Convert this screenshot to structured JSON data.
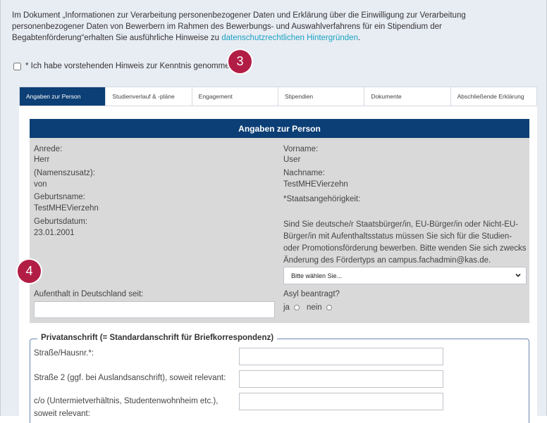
{
  "intro": {
    "text_before_link": "Im Dokument „Informationen zur Verarbeitung personenbezogener Daten und Erklärung über die Einwilligung zur Verarbeitung personenbezogener Daten von Bewerbern im Rahmen des Bewerbungs- und Auswahlverfahrens für ein Stipendium der Begabtenförderung“erhalten Sie ausführliche Hinweise zu ",
    "link_text": "datenschutzrechtlichen Hintergründen",
    "text_after_link": "."
  },
  "consent": {
    "label": "* Ich habe vorstehenden Hinweis zur Kenntnis genommen"
  },
  "badges": {
    "three": "3",
    "four": "4"
  },
  "tabs": [
    {
      "label": "Angaben zur Person"
    },
    {
      "label": "Studienverlauf & -pläne"
    },
    {
      "label": "Engagement"
    },
    {
      "label": "Stipendien"
    },
    {
      "label": "Dokumente"
    },
    {
      "label": "Abschließende Erklärung"
    }
  ],
  "section": {
    "title": "Angaben zur Person"
  },
  "person": {
    "anrede_label": "Anrede:",
    "anrede_value": "Herr",
    "namenszusatz_label": "(Namenszusatz):",
    "namenszusatz_value": "von",
    "geburtsname_label": "Geburtsname:",
    "geburtsname_value": "TestMHEVierzehn",
    "geburtsdatum_label": "Geburtsdatum:",
    "geburtsdatum_value": "23.01.2001",
    "vorname_label": "Vorname:",
    "vorname_value": "User",
    "nachname_label": "Nachname:",
    "nachname_value": "TestMHEVierzehn",
    "staat_label": "*Staatsangehörigkeit:",
    "staat_hint": "Sind Sie deutsche/r Staatsbürger/in, EU-Bürger/in oder Nicht-EU-Bürger/in mit Aufenthaltsstatus müssen Sie sich für die Studien- oder Promotionsförderung bewerben. Bitte wenden Sie sich zwecks Änderung des Fördertyps an campus.fachadmin@kas.de.",
    "staat_select": "Bitte wählen Sie...",
    "aufenthalt_label": "Aufenthalt in Deutschland seit:",
    "asyl_label": "Asyl beantragt?",
    "asyl_ja": "ja",
    "asyl_nein": "nein"
  },
  "address": {
    "legend": "Privatanschrift (= Standardanschrift für Briefkorrespondenz)",
    "street_label": "Straße/Hausnr.*:",
    "street2_label": "Straße 2 (ggf. bei Auslandsanschrift), soweit relevant:",
    "co_label": "c/o (Untermietverhältnis, Studentenwohnheim etc.), soweit relevant:"
  },
  "colors": {
    "navy": "#0c3f75",
    "badge": "#b21d45",
    "link": "#1aa3c4",
    "gray_panel": "#d9d9d9"
  }
}
